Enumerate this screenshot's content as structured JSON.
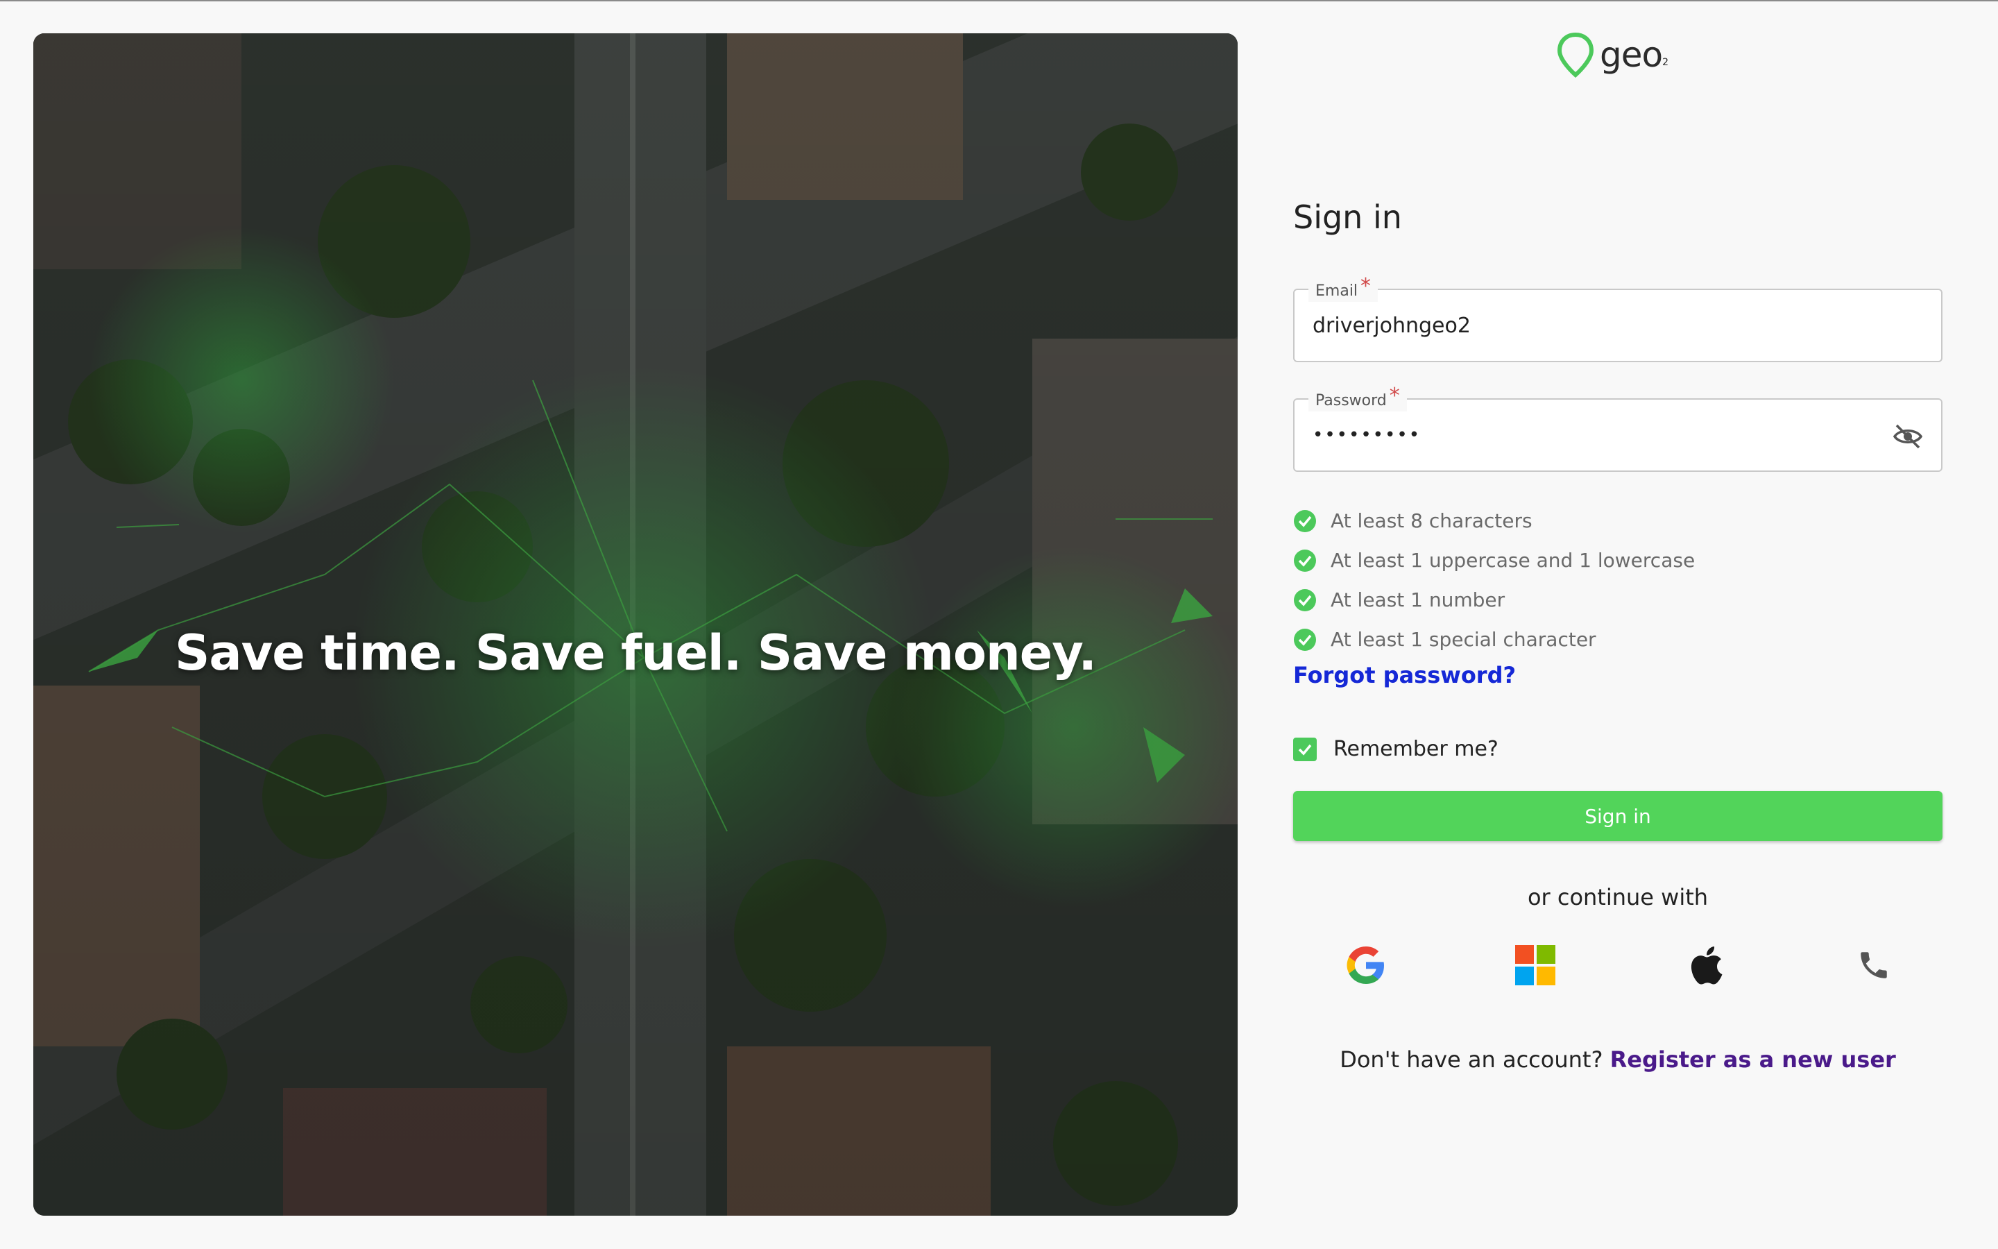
{
  "hero": {
    "tagline": "Save time. Save fuel. Save money."
  },
  "brand": {
    "name": "geo",
    "subscript": "2",
    "accent_color": "#4cc95b"
  },
  "form": {
    "title": "Sign in",
    "email": {
      "label": "Email",
      "required_mark": "*",
      "value": "driverjohngeo2"
    },
    "password": {
      "label": "Password",
      "required_mark": "*",
      "value": "•••••••••",
      "toggle_icon": "eye-off-icon"
    },
    "rules": [
      {
        "text": "At least 8 characters",
        "met": true
      },
      {
        "text": "At least 1 uppercase and 1 lowercase",
        "met": true
      },
      {
        "text": "At least 1 number",
        "met": true
      },
      {
        "text": "At least 1 special character",
        "met": true
      }
    ],
    "forgot_label": "Forgot password?",
    "remember_label": "Remember me?",
    "remember_checked": true,
    "submit_label": "Sign in",
    "submit_color": "#52d45a",
    "or_label": "or continue with",
    "providers": [
      "google-icon",
      "microsoft-icon",
      "apple-icon",
      "phone-icon"
    ],
    "register_prompt": "Don't have an account?",
    "register_link": "Register as a new user"
  }
}
